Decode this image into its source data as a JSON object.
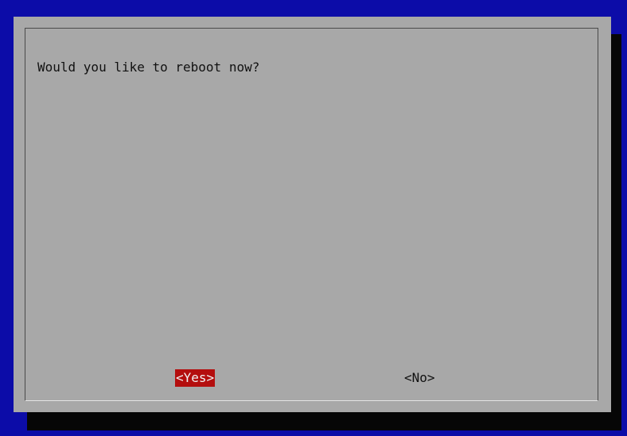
{
  "dialog": {
    "message": "Would you like to reboot now?",
    "buttons": {
      "yes_label": "<Yes>",
      "no_label": "<No>"
    },
    "selected_button": "yes"
  },
  "colors": {
    "screen_background": "#0c0ca8",
    "dialog_background": "#a8a8a8",
    "shadow": "#060606",
    "selected_button_background": "#b40e0e",
    "selected_button_text": "#f2f2f2",
    "text": "#111111"
  }
}
